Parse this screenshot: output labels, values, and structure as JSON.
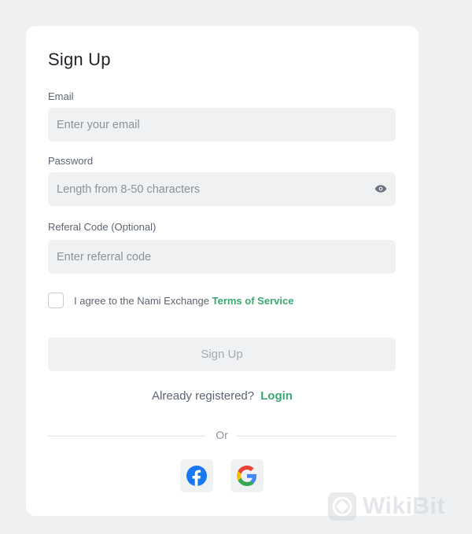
{
  "form": {
    "title": "Sign Up",
    "email": {
      "label": "Email",
      "placeholder": "Enter your email",
      "value": ""
    },
    "password": {
      "label": "Password",
      "placeholder": "Length from 8-50 characters",
      "value": "",
      "toggle_icon": "eye-icon"
    },
    "referral": {
      "label": "Referal Code (Optional)",
      "placeholder": "Enter referral code",
      "value": ""
    },
    "agree": {
      "checked": false,
      "text": "I agree to the Nami Exchange ",
      "link_label": "Terms of Service"
    },
    "submit_label": "Sign Up",
    "login_prompt": "Already registered?",
    "login_label": "Login",
    "divider_label": "Or",
    "social": [
      {
        "name": "facebook",
        "icon": "facebook-icon",
        "color": "#1877f2"
      },
      {
        "name": "google",
        "icon": "google-icon",
        "color": "#4285f4"
      }
    ]
  },
  "watermark": {
    "text": "WikiBit",
    "icon": "wikibit-logo-icon"
  },
  "colors": {
    "background": "#eef0f2",
    "card": "#ffffff",
    "input_bg": "#f0f1f3",
    "accent": "#3aa874",
    "text_primary": "#1f2328",
    "text_secondary": "#5d6570",
    "placeholder": "#8b929b",
    "disabled_text": "#a4aab1"
  }
}
